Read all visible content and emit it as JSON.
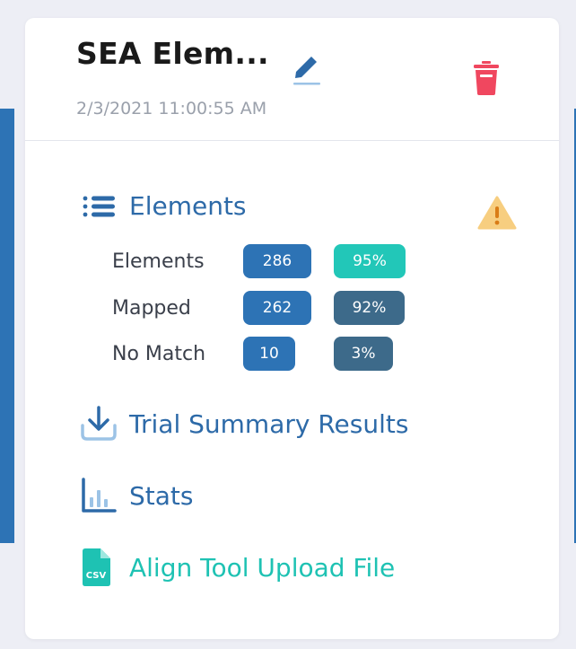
{
  "card": {
    "title": "SEA Elem...",
    "timestamp": "2/3/2021 11:00:55 AM"
  },
  "elements_section": {
    "label": "Elements",
    "rows": [
      {
        "label": "Elements",
        "count": "286",
        "percent": "95%"
      },
      {
        "label": "Mapped",
        "count": "262",
        "percent": "92%"
      },
      {
        "label": "No Match",
        "count": "10",
        "percent": "3%"
      }
    ]
  },
  "links": {
    "trial_summary": "Trial Summary Results",
    "stats": "Stats",
    "align_upload": "Align Tool Upload File"
  },
  "icons": {
    "edit": "pencil-icon",
    "delete": "trash-icon",
    "warning": "warning-icon",
    "list": "list-icon",
    "download": "download-icon",
    "stats": "bar-chart-icon",
    "csv": "csv-file-icon",
    "csv_text": "CSV"
  },
  "colors": {
    "primary_blue": "#2d6aa8",
    "badge_blue": "#2d73b5",
    "badge_teal": "#22c7b8",
    "badge_slate": "#3d6a8a",
    "danger_red": "#f0475f",
    "warning_yellow": "#f5b73d",
    "teal_link": "#1ec2b3"
  }
}
